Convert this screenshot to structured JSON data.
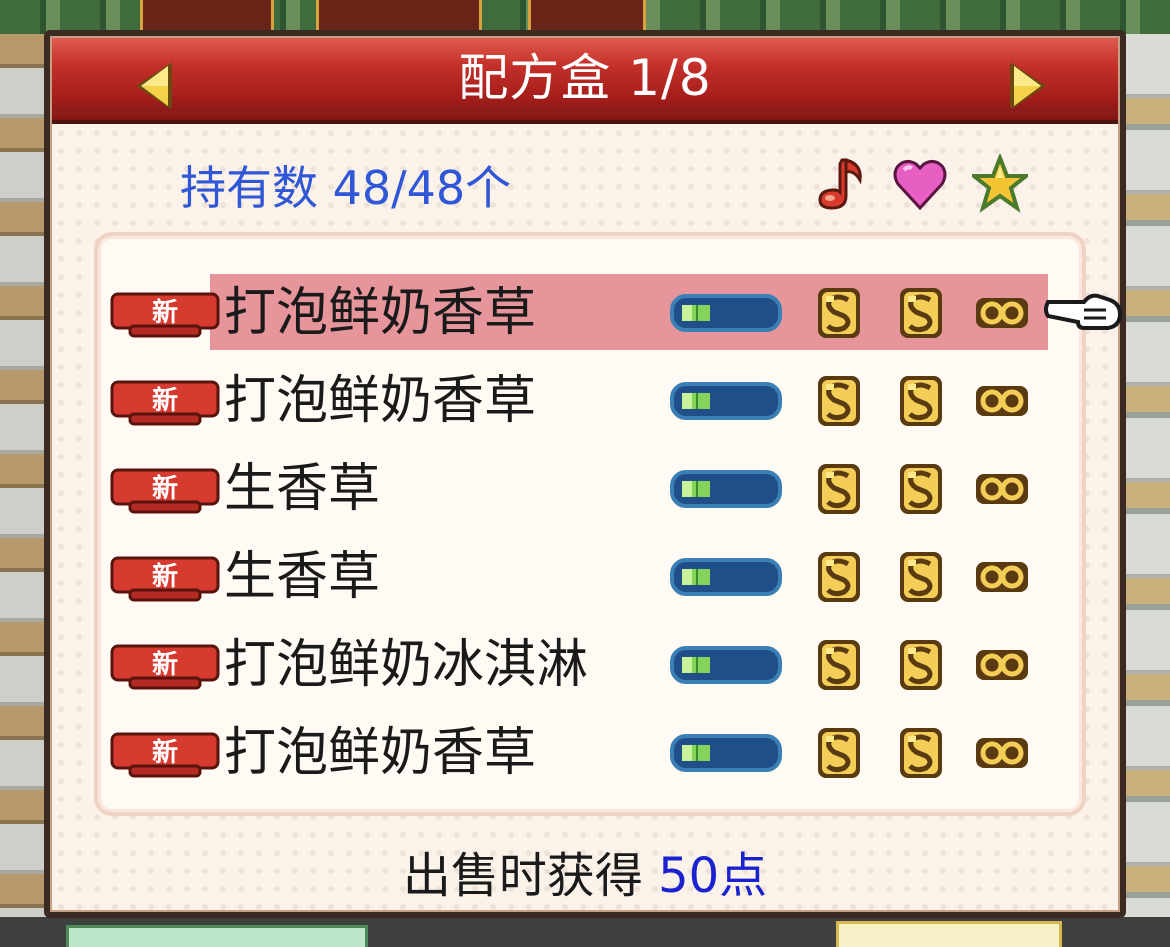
{
  "dialog": {
    "title": "配方盒 1/8",
    "prev_icon": "triangle-left-icon",
    "next_icon": "triangle-right-icon"
  },
  "owned": {
    "label": "持有数 48/48个"
  },
  "type_icons": [
    "music-note-icon",
    "heart-icon",
    "star-icon"
  ],
  "recipes": [
    {
      "badge": "新",
      "name": "打泡鲜奶香草",
      "selected": true
    },
    {
      "badge": "新",
      "name": "打泡鲜奶香草",
      "selected": false
    },
    {
      "badge": "新",
      "name": "生香草",
      "selected": false
    },
    {
      "badge": "新",
      "name": "生香草",
      "selected": false
    },
    {
      "badge": "新",
      "name": "打泡鲜奶冰淇淋",
      "selected": false
    },
    {
      "badge": "新",
      "name": "打泡鲜奶香草",
      "selected": false
    }
  ],
  "sell": {
    "label": "出售时获得",
    "points": "50点"
  },
  "colors": {
    "title_bar": "#c22f28",
    "owned_text": "#2f57d6",
    "points_text": "#1a22cf",
    "selected_row": "#e6959b",
    "badge": "#d63a2e"
  }
}
